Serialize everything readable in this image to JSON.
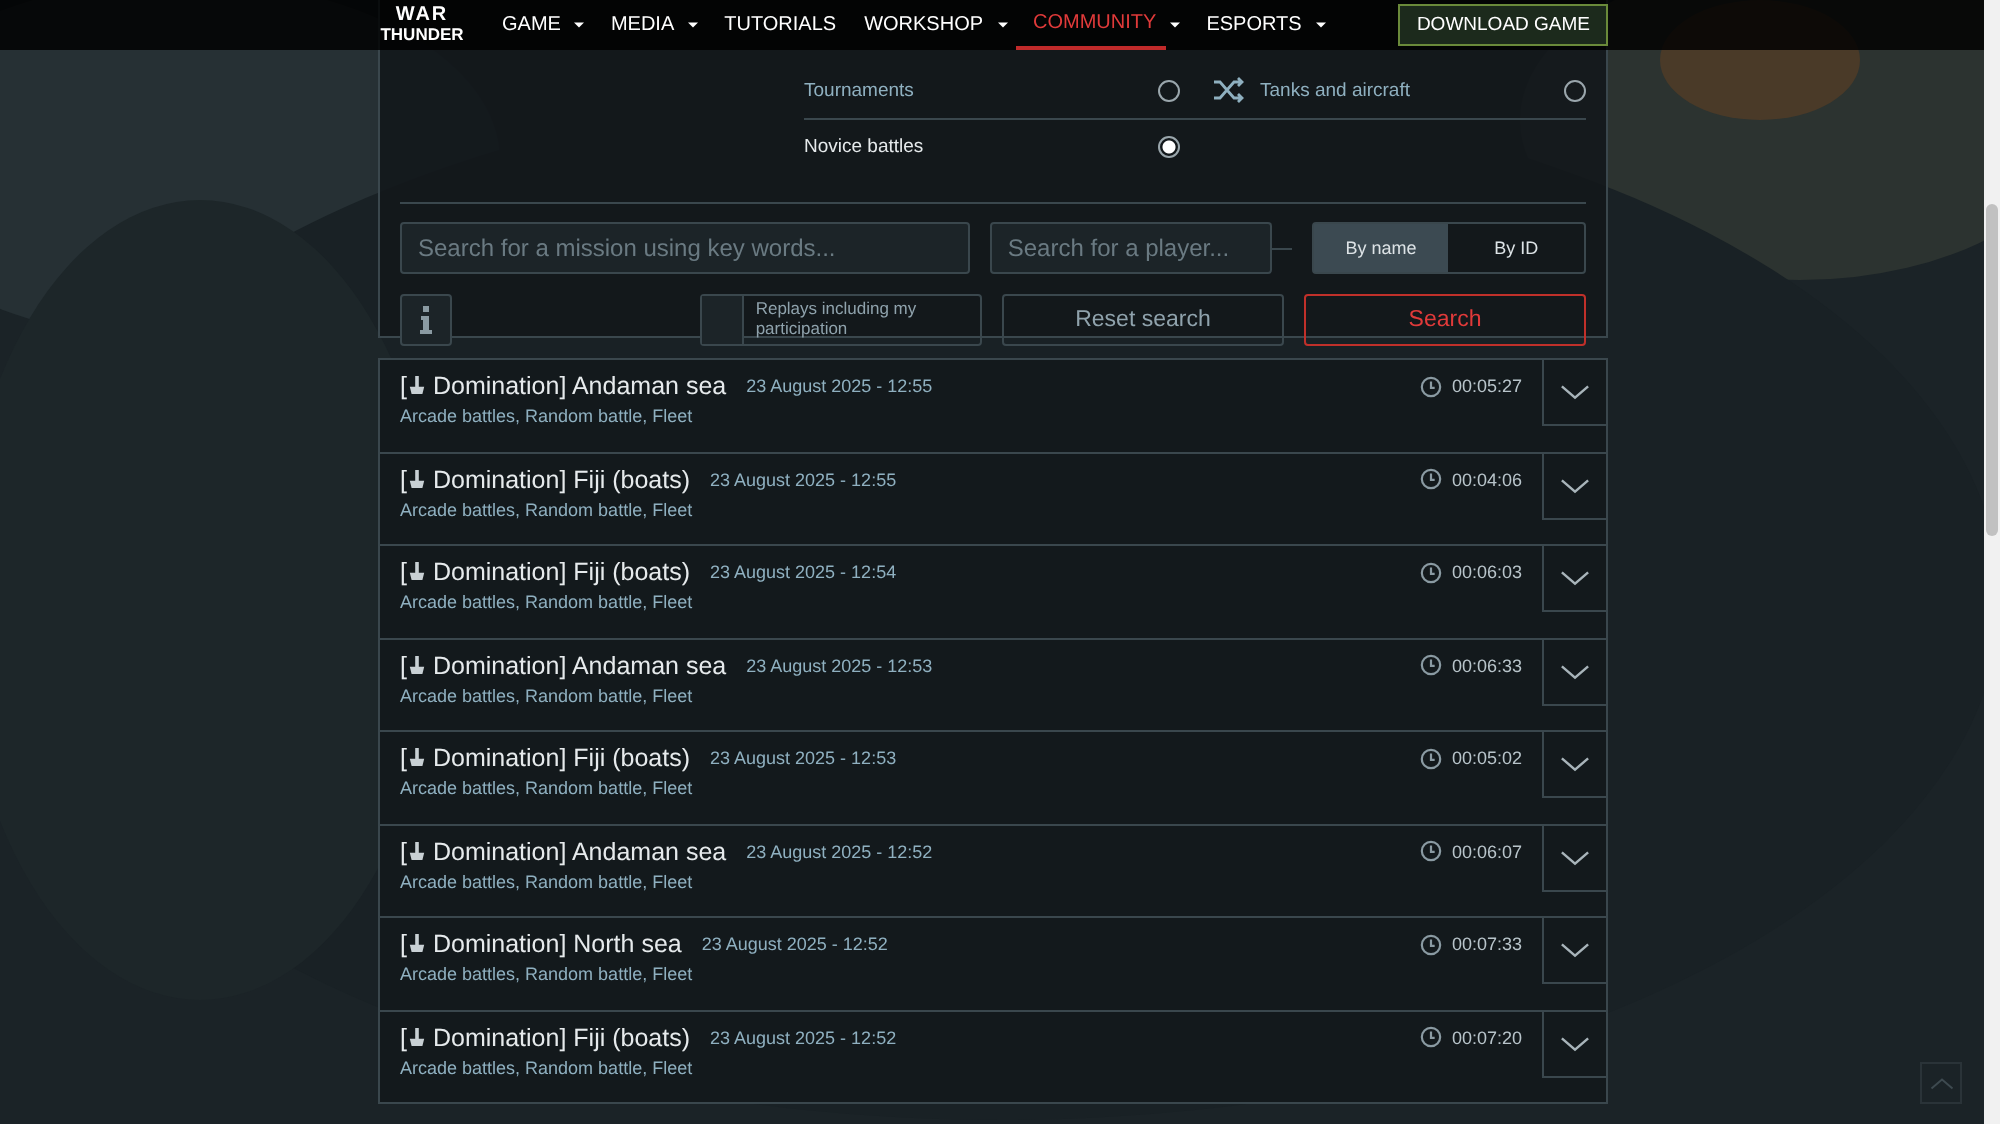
{
  "nav": {
    "logo": [
      "WAR",
      "THUNDER"
    ],
    "items": [
      {
        "label": "GAME",
        "dropdown": true,
        "selected": false
      },
      {
        "label": "MEDIA",
        "dropdown": true,
        "selected": false
      },
      {
        "label": "TUTORIALS",
        "dropdown": false,
        "selected": false
      },
      {
        "label": "WORKSHOP",
        "dropdown": true,
        "selected": false
      },
      {
        "label": "COMMUNITY",
        "dropdown": true,
        "selected": true
      },
      {
        "label": "ESPORTS",
        "dropdown": true,
        "selected": false
      }
    ],
    "cta": "DOWNLOAD GAME"
  },
  "filters": {
    "rows": [
      [
        {
          "label": "Tournaments",
          "selected": false
        },
        {
          "label": "Tanks and aircraft",
          "selected": false
        }
      ],
      [
        {
          "label": "Novice battles",
          "selected": true
        },
        null
      ]
    ]
  },
  "search": {
    "mission_placeholder": "Search for a mission using key words...",
    "player_placeholder": "Search for a player...",
    "modes": [
      {
        "label": "By name",
        "selected": true
      },
      {
        "label": "By ID",
        "selected": false
      }
    ],
    "participation": {
      "label": "Replays including my participation",
      "checked": false
    },
    "reset": "Reset search",
    "submit": "Search"
  },
  "replays": [
    {
      "bracket": "[",
      "title": "Domination] Andaman sea",
      "date": "23 August 2025 - 12:55",
      "tags": "Arcade battles, Random battle, Fleet",
      "duration": "00:05:27"
    },
    {
      "bracket": "[",
      "title": "Domination] Fiji (boats)",
      "date": "23 August 2025 - 12:55",
      "tags": "Arcade battles, Random battle, Fleet",
      "duration": "00:04:06"
    },
    {
      "bracket": "[",
      "title": "Domination] Fiji (boats)",
      "date": "23 August 2025 - 12:54",
      "tags": "Arcade battles, Random battle, Fleet",
      "duration": "00:06:03"
    },
    {
      "bracket": "[",
      "title": "Domination] Andaman sea",
      "date": "23 August 2025 - 12:53",
      "tags": "Arcade battles, Random battle, Fleet",
      "duration": "00:06:33"
    },
    {
      "bracket": "[",
      "title": "Domination] Fiji (boats)",
      "date": "23 August 2025 - 12:53",
      "tags": "Arcade battles, Random battle, Fleet",
      "duration": "00:05:02"
    },
    {
      "bracket": "[",
      "title": "Domination] Andaman sea",
      "date": "23 August 2025 - 12:52",
      "tags": "Arcade battles, Random battle, Fleet",
      "duration": "00:06:07"
    },
    {
      "bracket": "[",
      "title": "Domination] North sea",
      "date": "23 August 2025 - 12:52",
      "tags": "Arcade battles, Random battle, Fleet",
      "duration": "00:07:33"
    },
    {
      "bracket": "[",
      "title": "Domination] Fiji (boats)",
      "date": "23 August 2025 - 12:52",
      "tags": "Arcade battles, Random battle, Fleet",
      "duration": "00:07:20"
    }
  ]
}
